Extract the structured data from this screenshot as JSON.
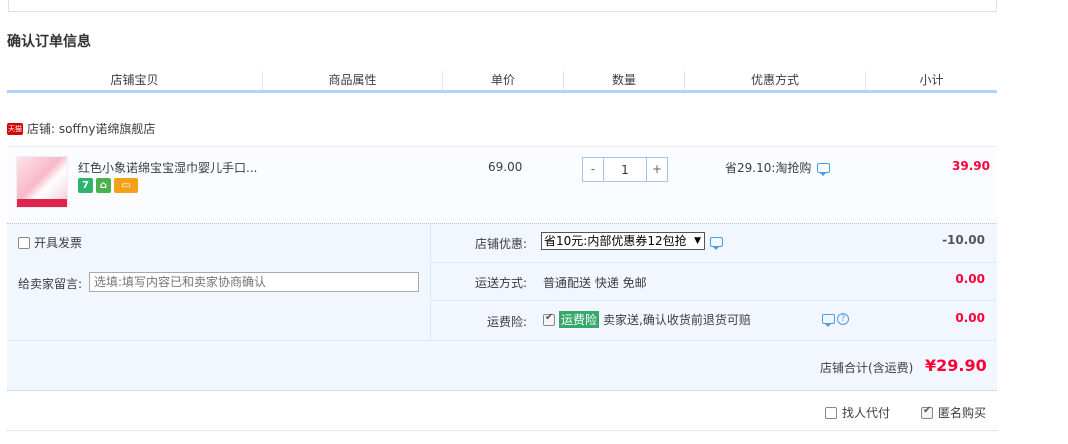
{
  "page": {
    "title": "确认订单信息"
  },
  "columns": [
    "店铺宝贝",
    "商品属性",
    "单价",
    "数量",
    "优惠方式",
    "小计"
  ],
  "shop": {
    "badge": "天猫",
    "label": "店铺: soffny诺绵旗舰店"
  },
  "item": {
    "title": "红色小象诺绵宝宝湿巾婴儿手口...",
    "service_icons": [
      "seven-day-return-icon",
      "guarantee-icon",
      "card-icon"
    ],
    "price": "69.00",
    "quantity": {
      "minus": "-",
      "value": "1",
      "plus": "+"
    },
    "promotion": "省29.10:淘抢购",
    "subtotal": "39.90"
  },
  "options": {
    "invoice_label": "开具发票",
    "message_label": "给卖家留言:",
    "message_placeholder": "选填:填写内容已和卖家协商确认",
    "shop_discount_label": "店铺优惠:",
    "shop_discount_selected": "省10元:内部优惠券12包抢",
    "shop_discount_value": "-10.00",
    "shipping_label": "运送方式:",
    "shipping_value": "普通配送 快递 免邮",
    "shipping_cost": "0.00",
    "insurance_label": "运费险:",
    "insurance_tag": "运费险",
    "insurance_text": "卖家送,确认收货前退货可赔",
    "insurance_cost": "0.00"
  },
  "total": {
    "label": "店铺合计(含运费)",
    "value": "¥29.90"
  },
  "bottom": {
    "proxy_pay": "找人代付",
    "anonymous": "匿名购买"
  },
  "colors": {
    "accent_red": "#ff0036",
    "header_border": "#b2d1ff",
    "panel_bg": "#f2f7ff"
  }
}
